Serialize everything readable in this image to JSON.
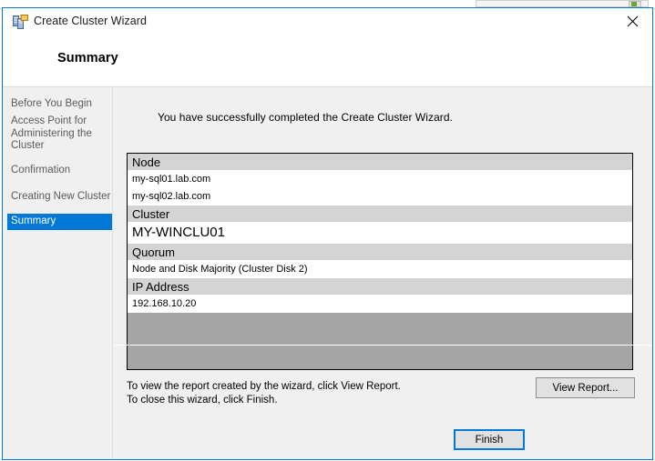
{
  "window": {
    "title": "Create Cluster Wizard",
    "title_icon": "cluster-servers-icon",
    "close_icon": "close-icon",
    "accent_color": "#0078d7",
    "chrome_background": "#f0f0f0"
  },
  "header": {
    "page_title": "Summary"
  },
  "sidebar": {
    "items": [
      {
        "label": "Before You Begin",
        "selected": false
      },
      {
        "label": "Access Point for Administering the Cluster",
        "selected": false
      },
      {
        "label": "Confirmation",
        "selected": false
      },
      {
        "label": "Creating New Cluster",
        "selected": false
      },
      {
        "label": "Summary",
        "selected": true
      }
    ],
    "selected_color": "#0078d7"
  },
  "content": {
    "success_message": "You have successfully completed the Create Cluster Wizard.",
    "summary_table": {
      "section_header_color": "#d4d4d4",
      "filler_color": "#a6a6a6",
      "rows": [
        {
          "type": "section",
          "label": "Node"
        },
        {
          "type": "value",
          "label": "my-sql01.lab.com"
        },
        {
          "type": "value",
          "label": "my-sql02.lab.com"
        },
        {
          "type": "section",
          "label": "Cluster"
        },
        {
          "type": "value_large",
          "label": "MY-WINCLU01"
        },
        {
          "type": "section",
          "label": "Quorum"
        },
        {
          "type": "value",
          "label": "Node and Disk Majority (Cluster Disk 2)"
        },
        {
          "type": "section",
          "label": "IP Address"
        },
        {
          "type": "value",
          "label": "192.168.10.20"
        }
      ]
    },
    "footer_note_line1": "To view the report created by the wizard, click View Report.",
    "footer_note_line2": "To close this wizard, click Finish.",
    "view_report_button": "View Report..."
  },
  "buttons": {
    "finish": "Finish"
  }
}
